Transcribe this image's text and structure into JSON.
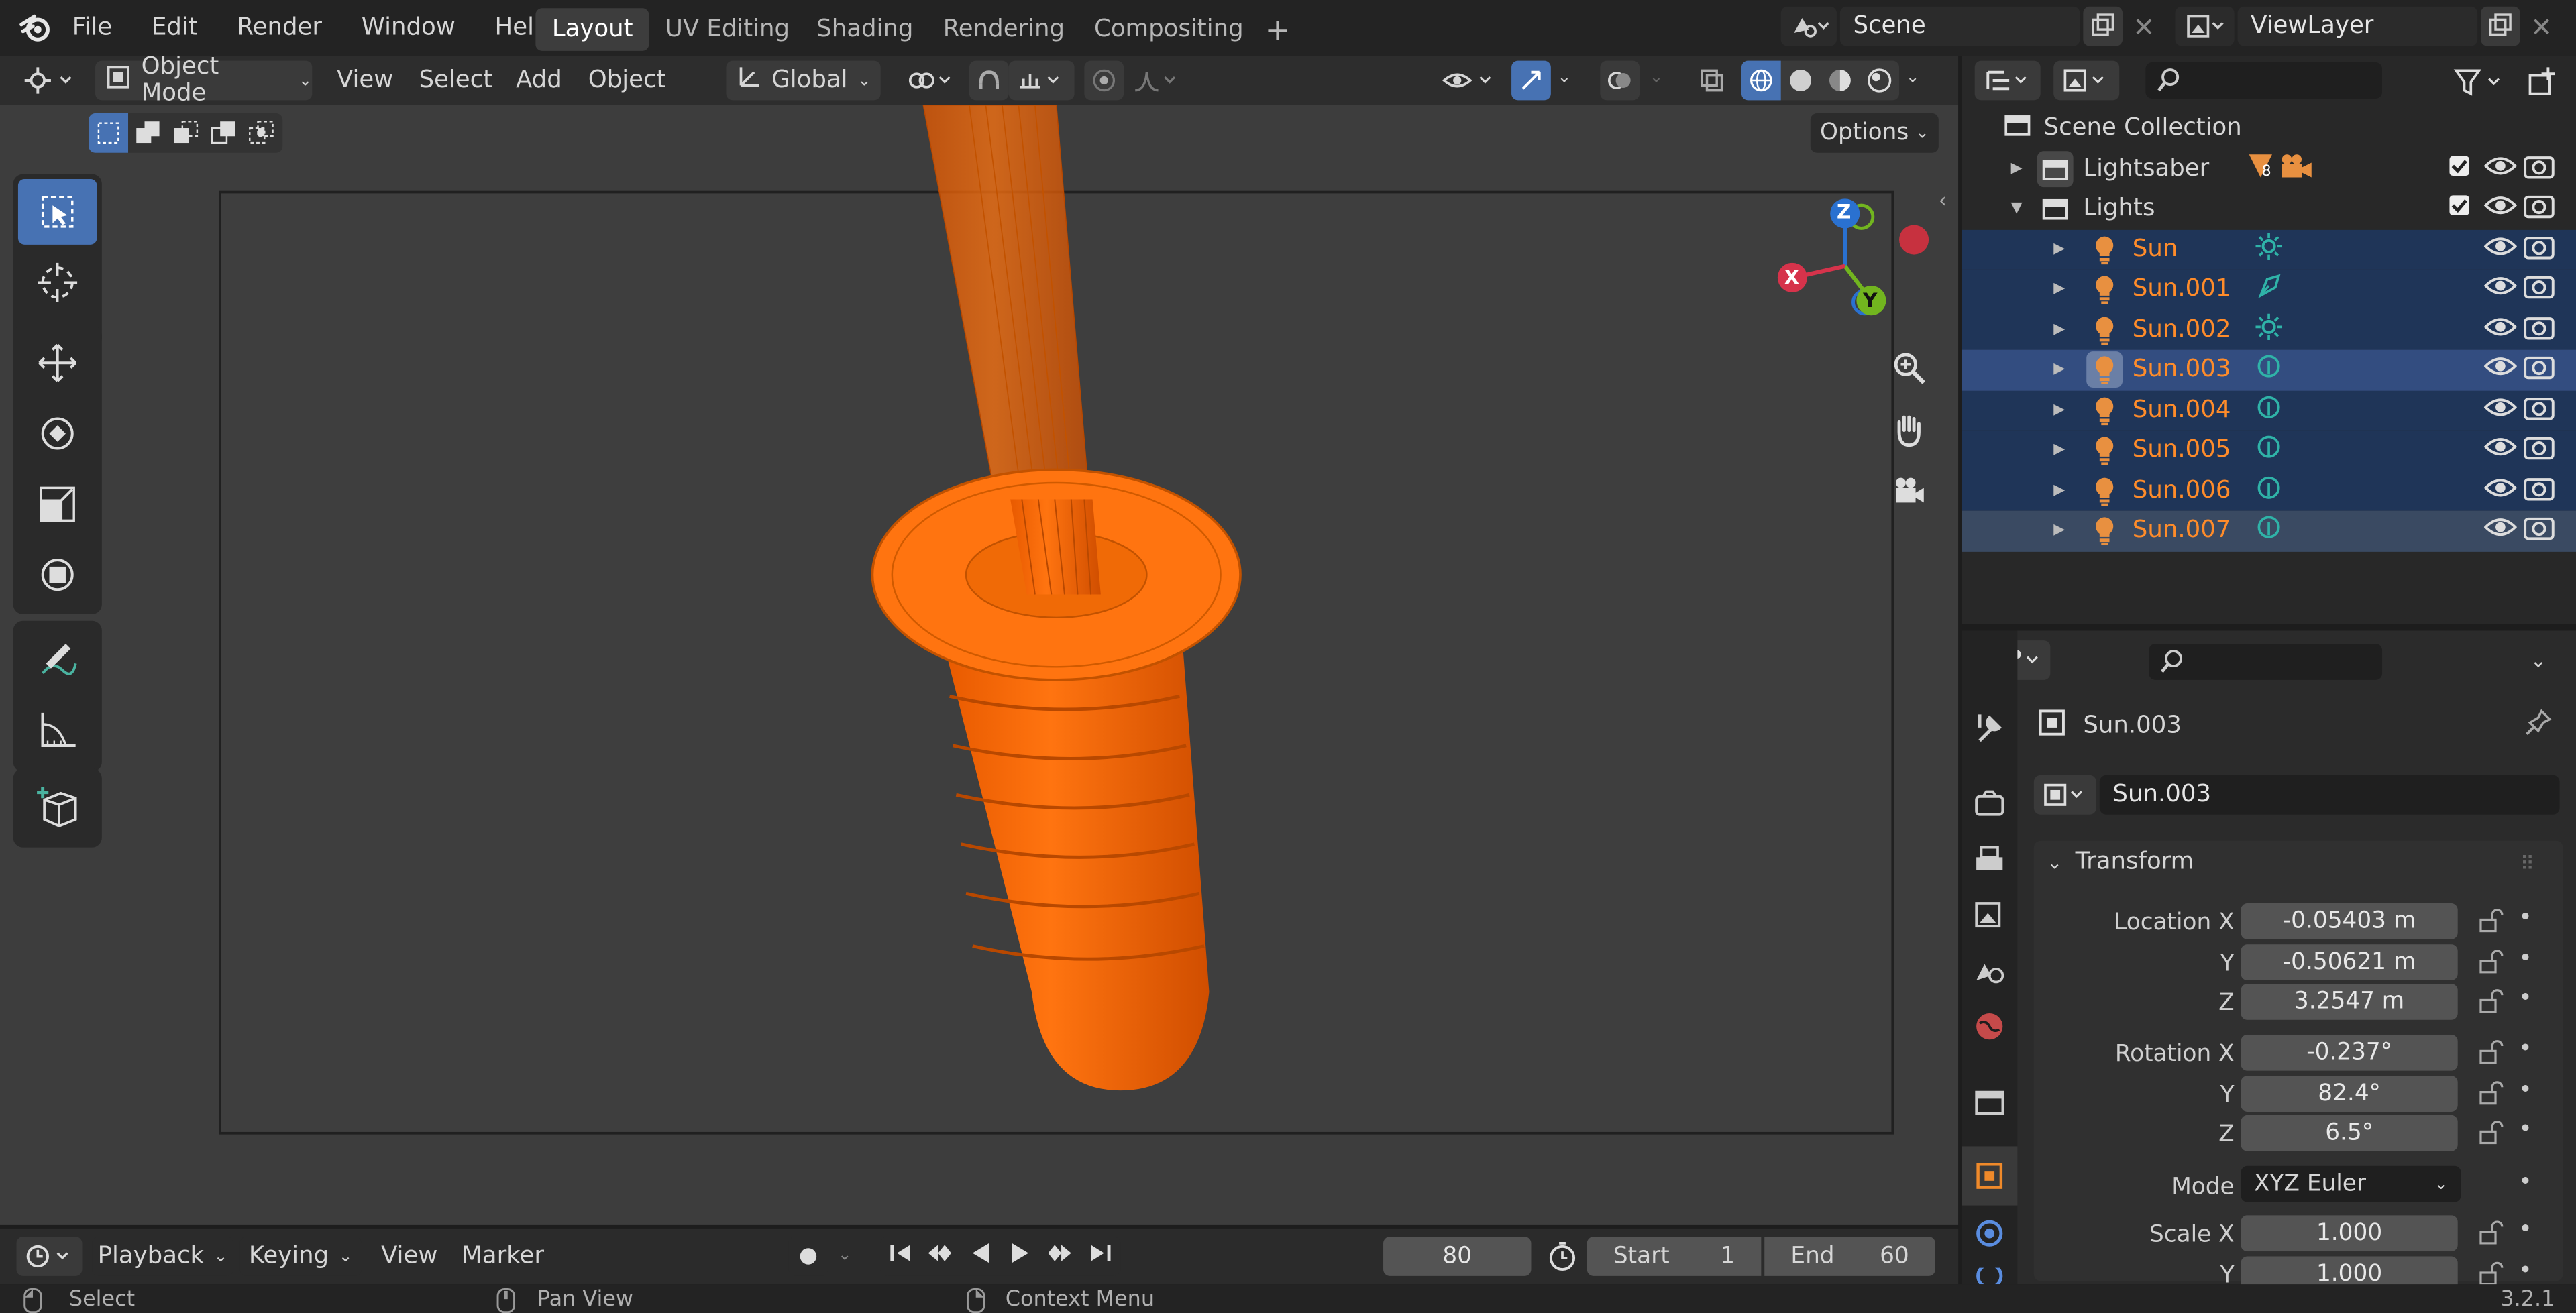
{
  "menu": {
    "file": "File",
    "edit": "Edit",
    "render": "Render",
    "window": "Window",
    "help": "Help"
  },
  "workspaces": [
    {
      "label": "Layout",
      "active": true
    },
    {
      "label": "UV Editing",
      "active": false
    },
    {
      "label": "Shading",
      "active": false
    },
    {
      "label": "Rendering",
      "active": false
    },
    {
      "label": "Compositing",
      "active": false
    }
  ],
  "scene": {
    "name": "Scene"
  },
  "viewlayer": {
    "name": "ViewLayer"
  },
  "viewport_header": {
    "mode": "Object Mode",
    "view": "View",
    "select": "Select",
    "add": "Add",
    "object": "Object",
    "orientation": "Global",
    "options": "Options"
  },
  "gizmo": {
    "x": "X",
    "y": "Y",
    "z": "Z"
  },
  "outliner": {
    "collection": "Scene Collection",
    "items": [
      {
        "label": "Lightsaber",
        "badge": "8"
      },
      {
        "label": "Lights"
      }
    ],
    "lights": [
      {
        "label": "Sun",
        "type": "sun-icon"
      },
      {
        "label": "Sun.001",
        "type": "spot-icon"
      },
      {
        "label": "Sun.002",
        "type": "sun-icon"
      },
      {
        "label": "Sun.003",
        "type": "point-icon",
        "active": true
      },
      {
        "label": "Sun.004",
        "type": "point-icon"
      },
      {
        "label": "Sun.005",
        "type": "point-icon"
      },
      {
        "label": "Sun.006",
        "type": "point-icon"
      },
      {
        "label": "Sun.007",
        "type": "point-icon"
      }
    ]
  },
  "properties": {
    "object_title": "Sun.003",
    "object_name": "Sun.003",
    "panel": "Transform",
    "location": {
      "label": "Location X",
      "x": "-0.05403 m",
      "y": "-0.50621 m",
      "z": "3.2547 m"
    },
    "rotation": {
      "label": "Rotation X",
      "x": "-0.237°",
      "y": "82.4°",
      "z": "6.5°"
    },
    "mode_label": "Mode",
    "mode_value": "XYZ Euler",
    "scale": {
      "label": "Scale X",
      "x": "1.000",
      "y": "1.000"
    },
    "axis_y": "Y",
    "axis_z": "Z"
  },
  "timeline": {
    "playback": "Playback",
    "keying": "Keying",
    "view": "View",
    "marker": "Marker",
    "current_frame": "80",
    "start_label": "Start",
    "start": "1",
    "end_label": "End",
    "end": "60"
  },
  "statusbar": {
    "select": "Select",
    "pan": "Pan View",
    "context": "Context Menu",
    "version": "3.2.1"
  },
  "colors": {
    "accent": "#4772b3",
    "selected_text": "#ff8c2a",
    "object_orange": "#ff6a00",
    "light_teal": "#2fb3a8"
  }
}
